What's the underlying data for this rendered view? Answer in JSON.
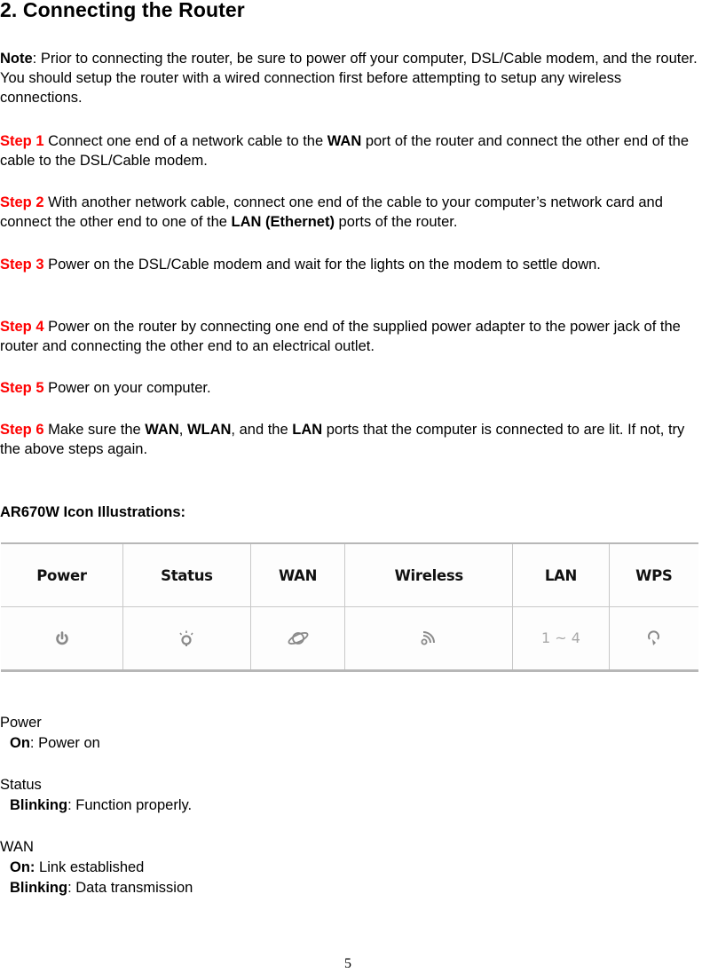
{
  "title": "2. Connecting the Router",
  "note": {
    "label": "Note",
    "text": ": Prior to connecting the router, be sure to power off your computer, DSL/Cable modem, and the router. You should setup the router with a wired connection first before attempting to setup any wireless connections."
  },
  "steps": [
    {
      "label": "Step 1",
      "parts": [
        " Connect one end of a network cable to the ",
        {
          "b": "WAN"
        },
        " port of the router and connect the other end of the cable to the DSL/Cable modem."
      ]
    },
    {
      "label": "Step 2",
      "parts": [
        " With another network cable, connect one end of the cable to your computer’s network card and connect the other end to one of the ",
        {
          "b": "LAN (Ethernet)"
        },
        " ports of the router."
      ]
    },
    {
      "label": "Step 3",
      "parts": [
        " Power on the DSL/Cable modem and wait for the lights on the modem to settle down."
      ]
    },
    {
      "label": "Step 4",
      "parts": [
        " Power on the router by connecting one end of the supplied power adapter to the power jack of the router and connecting the other end to an electrical outlet."
      ]
    },
    {
      "label": "Step 5",
      "parts": [
        " Power on your computer."
      ]
    },
    {
      "label": "Step 6",
      "parts": [
        " Make sure the ",
        {
          "b": "WAN"
        },
        ", ",
        {
          "b": "WLAN"
        },
        ", and the ",
        {
          "b": "LAN"
        },
        " ports that the computer is connected to are lit. If not, try the above steps again."
      ]
    }
  ],
  "icons_heading": "AR670W Icon Illustrations:",
  "icon_table": {
    "headers": [
      "Power",
      "Status",
      "WAN",
      "Wireless",
      "LAN",
      "WPS"
    ],
    "icons": [
      "power-icon",
      "status-light-icon",
      "wan-globe-icon",
      "wireless-signal-icon",
      "lan-range",
      "wps-icon"
    ],
    "lan_range": "1 ~ 4"
  },
  "legend": [
    {
      "name": "Power",
      "states": [
        {
          "state": "On",
          "sep": ": ",
          "desc": "Power on"
        }
      ]
    },
    {
      "name": "Status",
      "states": [
        {
          "state": "Blinking",
          "sep": ": ",
          "desc": "Function properly."
        }
      ]
    },
    {
      "name": "WAN",
      "states": [
        {
          "state": "On:",
          "sep": " ",
          "desc": "Link established"
        },
        {
          "state": "Blinking",
          "sep": ": ",
          "desc": "Data transmission"
        }
      ]
    }
  ],
  "page_number": "5",
  "colors": {
    "step_label": "#ff0000",
    "icon_gray": "#8a8a8a",
    "table_border": "#c8c8c8"
  }
}
